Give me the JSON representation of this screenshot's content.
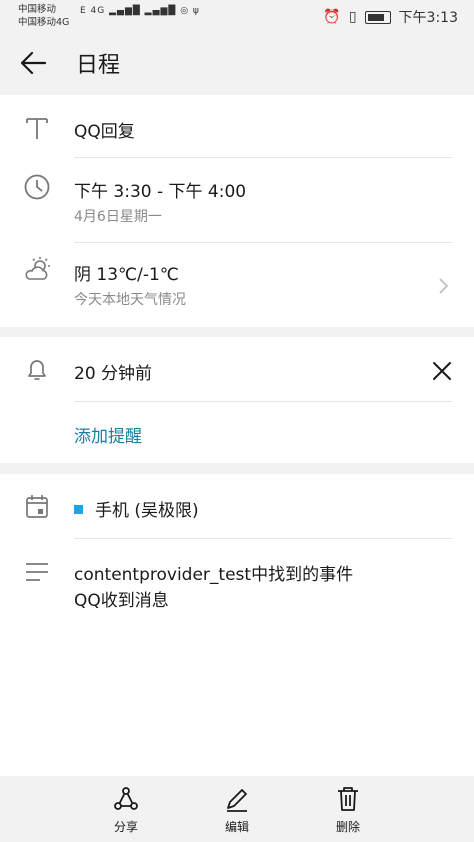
{
  "status": {
    "carrier1": "中国移动",
    "carrier2": "中国移动4G",
    "signal_label": "E 4G",
    "time": "下午3:13"
  },
  "appbar": {
    "title": "日程"
  },
  "event": {
    "title": "QQ回复",
    "time_range": "下午 3:30 - 下午 4:00",
    "date": "4月6日星期一",
    "weather": "阴 13℃/-1℃",
    "weather_sub": "今天本地天气情况"
  },
  "reminder": {
    "value": "20 分钟前",
    "add_label": "添加提醒"
  },
  "calendar": {
    "name": "手机 (吴极限)",
    "color": "#1ea3e6"
  },
  "description": {
    "line1": "contentprovider_test中找到的事件",
    "line2": "QQ收到消息"
  },
  "actions": {
    "share": "分享",
    "edit": "编辑",
    "delete": "删除"
  }
}
